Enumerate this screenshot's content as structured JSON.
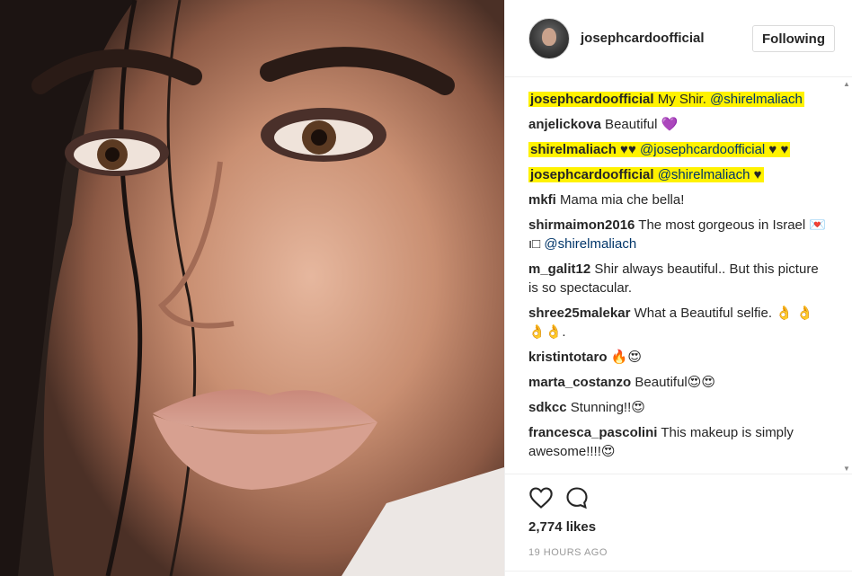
{
  "header": {
    "username": "josephcardoofficial",
    "follow_label": "Following"
  },
  "comments": [
    {
      "user": "josephcardoofficial",
      "text": " My Shir. ",
      "mention": "@shirelmaliach",
      "tail": "",
      "highlight": true
    },
    {
      "user": "anjelickova",
      "text": " Beautiful 💜",
      "mention": "",
      "tail": "",
      "highlight": false
    },
    {
      "user": "shirelmaliach",
      "text": " ♥♥ ",
      "mention": "@josephcardoofficial",
      "tail": " ♥ ♥",
      "highlight": true
    },
    {
      "user": "josephcardoofficial",
      "text": " ",
      "mention": "@shirelmaliach",
      "tail": " ♥",
      "highlight": true
    },
    {
      "user": "mkfi",
      "text": " Mama mia che bella!",
      "mention": "",
      "tail": "",
      "highlight": false
    },
    {
      "user": "shirmaimon2016",
      "text": " The most gorgeous in Israel 💌ı□ ",
      "mention": "@shirelmaliach",
      "tail": "",
      "highlight": false
    },
    {
      "user": "m_galit12",
      "text": " Shir always beautiful.. But this picture is so spectacular.",
      "mention": "",
      "tail": "",
      "highlight": false
    },
    {
      "user": "shree25malekar",
      "text": " What a Beautiful selfie. 👌 👌👌👌.",
      "mention": "",
      "tail": "",
      "highlight": false
    },
    {
      "user": "kristintotaro",
      "text": " 🔥😍",
      "mention": "",
      "tail": "",
      "highlight": false
    },
    {
      "user": "marta_costanzo",
      "text": " Beautiful😍😍",
      "mention": "",
      "tail": "",
      "highlight": false
    },
    {
      "user": "sdkcc",
      "text": " Stunning!!😍",
      "mention": "",
      "tail": "",
      "highlight": false
    },
    {
      "user": "francesca_pascolini",
      "text": " This makeup is simply awesome!!!!😍",
      "mention": "",
      "tail": "",
      "highlight": false
    }
  ],
  "actions": {
    "like_icon": "heart-icon",
    "comment_icon": "speech-bubble-icon",
    "likes": "2,774 likes",
    "time": "19 HOURS AGO"
  },
  "colors": {
    "highlight": "#fff200",
    "mention": "#003569",
    "muted": "#999999",
    "border": "#efefef"
  }
}
